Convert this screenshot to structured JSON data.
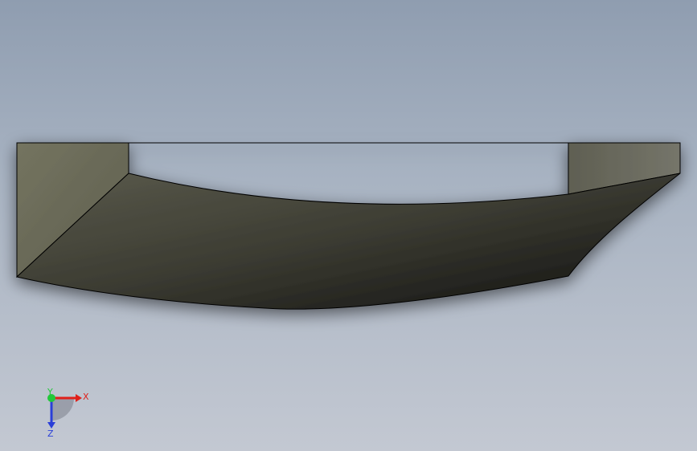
{
  "viewport": {
    "background_top": "#8f9db0",
    "background_bottom": "#c3c8d2"
  },
  "model": {
    "face_light": "#6f6f60",
    "face_dark": "#111111",
    "edge_color": "#000000"
  },
  "triad": {
    "x_label": "X",
    "y_label": "Y",
    "z_label": "Z",
    "x_color": "#e0201a",
    "y_color": "#22c83a",
    "z_color": "#2a3fd8"
  }
}
